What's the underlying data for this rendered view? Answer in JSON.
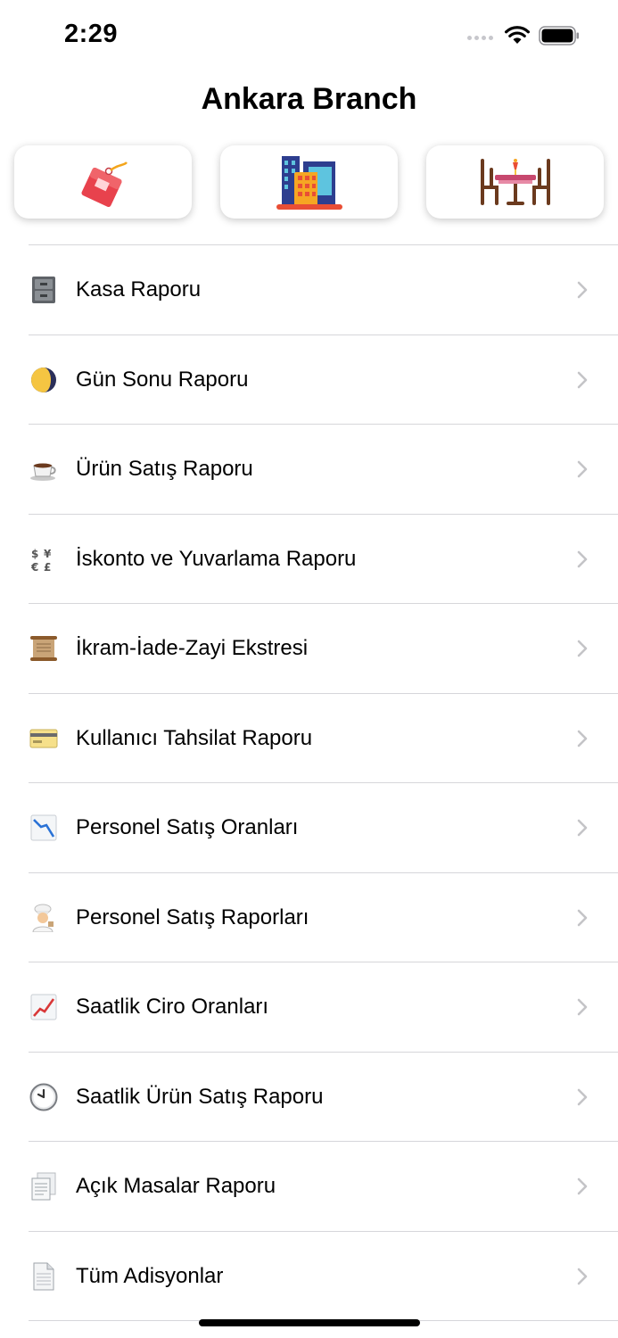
{
  "status_bar": {
    "time": "2:29"
  },
  "header": {
    "title": "Ankara Branch"
  },
  "shortcuts": [
    {
      "icon": "price-tag-icon"
    },
    {
      "icon": "buildings-icon"
    },
    {
      "icon": "dining-table-icon"
    }
  ],
  "menu": {
    "items": [
      {
        "label": "Kasa Raporu",
        "icon": "file-cabinet-icon"
      },
      {
        "label": "Gün Sonu Raporu",
        "icon": "moon-icon"
      },
      {
        "label": "Ürün Satış Raporu",
        "icon": "coffee-icon"
      },
      {
        "label": "İskonto ve Yuvarlama Raporu",
        "icon": "currency-exchange-icon"
      },
      {
        "label": "İkram-İade-Zayi Ekstresi",
        "icon": "scroll-icon"
      },
      {
        "label": "Kullanıcı Tahsilat Raporu",
        "icon": "credit-card-icon"
      },
      {
        "label": "Personel Satış Oranları",
        "icon": "chart-decreasing-icon"
      },
      {
        "label": "Personel Satış Raporları",
        "icon": "cook-icon"
      },
      {
        "label": "Saatlik Ciro Oranları",
        "icon": "chart-increasing-icon"
      },
      {
        "label": "Saatlik Ürün Satış Raporu",
        "icon": "clock-icon"
      },
      {
        "label": "Açık Masalar Raporu",
        "icon": "documents-icon"
      },
      {
        "label": "Tüm Adisyonlar",
        "icon": "page-icon"
      }
    ]
  }
}
